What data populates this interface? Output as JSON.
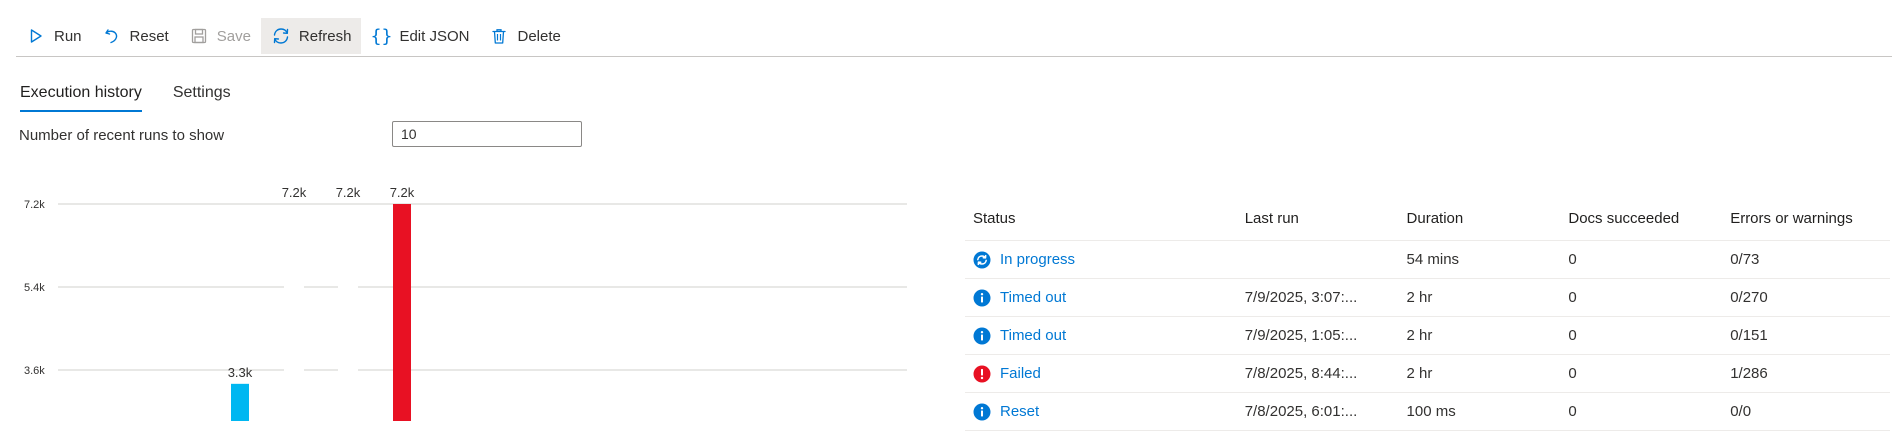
{
  "toolbar": {
    "run": "Run",
    "reset": "Reset",
    "save": "Save",
    "refresh": "Refresh",
    "edit_json": "Edit JSON",
    "delete": "Delete"
  },
  "tabs": [
    {
      "label": "Execution history",
      "active": true
    },
    {
      "label": "Settings",
      "active": false
    }
  ],
  "runs_setting": {
    "label": "Number of recent runs to show",
    "value": "10"
  },
  "chart_data": {
    "type": "bar",
    "ytick_labels": [
      "7.2k",
      "5.4k",
      "3.6k"
    ],
    "yticks": [
      7200,
      5400,
      3600
    ],
    "ylim": [
      1700,
      7200
    ],
    "bars": [
      {
        "value": 3300,
        "label": "3.3k",
        "color": "#00b7f1"
      },
      {
        "value": 7200,
        "label": "7.2k",
        "color": "#e81123",
        "label_only": true
      },
      {
        "value": 7200,
        "label": "7.2k",
        "color": "#e81123",
        "label_only": true
      },
      {
        "value": 7200,
        "label": "7.2k",
        "color": "#e81123"
      }
    ],
    "grid": true
  },
  "table": {
    "columns": [
      "Status",
      "Last run",
      "Duration",
      "Docs succeeded",
      "Errors or warnings"
    ],
    "rows": [
      {
        "status": "In progress",
        "icon": "sync-icon",
        "last_run": "",
        "duration": "54 mins",
        "docs": "0",
        "errors": "0/73"
      },
      {
        "status": "Timed out",
        "icon": "info-icon",
        "last_run": "7/9/2025, 3:07:...",
        "duration": "2 hr",
        "docs": "0",
        "errors": "0/270"
      },
      {
        "status": "Timed out",
        "icon": "info-icon",
        "last_run": "7/9/2025, 1:05:...",
        "duration": "2 hr",
        "docs": "0",
        "errors": "0/151"
      },
      {
        "status": "Failed",
        "icon": "error-icon",
        "last_run": "7/8/2025, 8:44:...",
        "duration": "2 hr",
        "docs": "0",
        "errors": "1/286"
      },
      {
        "status": "Reset",
        "icon": "info-icon",
        "last_run": "7/8/2025, 6:01:...",
        "duration": "100 ms",
        "docs": "0",
        "errors": "0/0"
      }
    ]
  },
  "colors": {
    "accent": "#0078d4",
    "bar_success": "#00b7f1",
    "bar_failed": "#e81123",
    "error": "#e81123"
  }
}
